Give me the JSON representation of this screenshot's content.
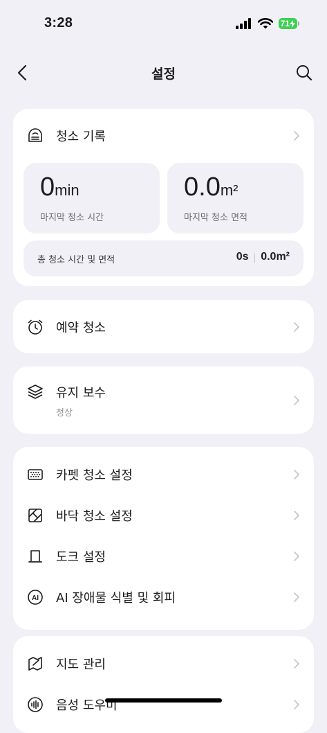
{
  "status": {
    "time": "3:28",
    "battery": "71"
  },
  "nav": {
    "title": "설정"
  },
  "history": {
    "label": "청소 기록",
    "last_time_value": "0",
    "last_time_unit": "min",
    "last_time_label": "마지막 청소 시간",
    "last_area_value": "0.0",
    "last_area_unit": "m²",
    "last_area_label": "마지막 청소 면적",
    "total_label": "총 청소 시간 및 면적",
    "total_time": "0s",
    "total_area": "0.0m²"
  },
  "schedule": {
    "label": "예약 청소"
  },
  "maintenance": {
    "label": "유지 보수",
    "status": "정상"
  },
  "settings": {
    "carpet": "카펫 청소 설정",
    "floor": "바닥 청소 설정",
    "dock": "도크 설정",
    "ai": "AI 장애물 식별 및 회피"
  },
  "more": {
    "map": "지도 관리",
    "voice": "음성 도우미"
  }
}
